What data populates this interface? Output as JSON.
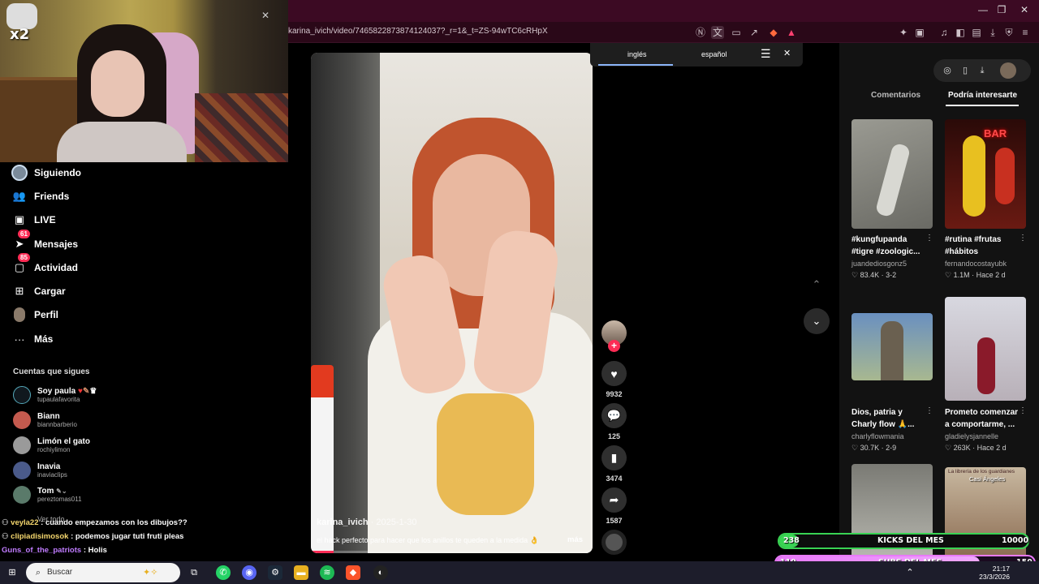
{
  "browser": {
    "url": "karina_ivich/video/7465822873874124037?_r=1&_t=ZS-94wTC6cRHpX"
  },
  "webcam": {
    "overlay_text": "x2"
  },
  "nav": {
    "items": [
      {
        "label": "Siguiendo",
        "icon": "avatar-icon"
      },
      {
        "label": "Friends",
        "icon": "friends-icon"
      },
      {
        "label": "LIVE",
        "icon": "live-icon"
      },
      {
        "label": "Mensajes",
        "icon": "messages-icon",
        "badge": "61"
      },
      {
        "label": "Actividad",
        "icon": "activity-icon",
        "badge": "85"
      },
      {
        "label": "Cargar",
        "icon": "upload-icon"
      },
      {
        "label": "Perfil",
        "icon": "profile-icon"
      },
      {
        "label": "Más",
        "icon": "more-icon"
      }
    ]
  },
  "following": {
    "title": "Cuentas que sigues",
    "accounts": [
      {
        "name": "Soy paula",
        "user": "tupaulafavorita",
        "avatar_color": "#10181e"
      },
      {
        "name": "Biann",
        "user": "biannbarberio",
        "avatar_color": "#c45a4e"
      },
      {
        "name": "Limón el gato",
        "user": "rochiylimon",
        "avatar_color": "#9a9a9a"
      },
      {
        "name": "Inavia",
        "user": "inaviaclips",
        "avatar_color": "#4a5a8a"
      },
      {
        "name": "Tom",
        "user": "pereztomas011",
        "avatar_color": "#5a7a6a"
      }
    ],
    "see_all": "Ver todo"
  },
  "chat": [
    {
      "user": "veyla22",
      "message": "cuando empezamos con los dibujos??",
      "color": "#f5d76e"
    },
    {
      "user": "clipiadisimosok",
      "message": "podemos jugar tuti fruti pleas",
      "color": "#f5d76e"
    },
    {
      "user": "Guns_of_the_patriots",
      "message": "Holis",
      "color": "#c07cff"
    }
  ],
  "video": {
    "author": "karina_ivich",
    "date": "2025-1-30",
    "caption": "el hack perfecto para hacer que los anillos te queden a la medida 👌",
    "more": "más",
    "progress": 0.08
  },
  "actions": {
    "likes": "9932",
    "comments": "125",
    "saves": "3474",
    "shares": "1587"
  },
  "translate": {
    "tab_source": "inglés",
    "tab_target": "español"
  },
  "panel": {
    "tabs": [
      "Comentarios",
      "Podría interesarte"
    ],
    "active_tab": 1,
    "cards": [
      {
        "title": "#kungfupanda #tigre #zoologic...",
        "user": "juandediosgonz5",
        "likes": "83.4K",
        "date": "3-2",
        "thumb_color": "#8a8a86"
      },
      {
        "title": "#rutina #frutas #hábitos",
        "user": "fernandocostayubk",
        "likes": "1.1M",
        "date": "Hace 2 d",
        "thumb_color": "#4a1a14",
        "thumb_text": "BAR"
      },
      {
        "title": "Dios, patria y Charly flow 🙏...",
        "user": "charlyflowmania",
        "likes": "30.7K",
        "date": "2-9",
        "thumb_color": "#7aa0c8"
      },
      {
        "title": "Prometo comenzar a comportarme, ...",
        "user": "gladielysjannelle",
        "likes": "263K",
        "date": "Hace 2 d",
        "thumb_color": "#c8c8d0"
      },
      {
        "title": "",
        "user": "",
        "likes": "",
        "date": "",
        "thumb_color": "#6a6a66"
      },
      {
        "title": "",
        "user": "",
        "likes": "",
        "date": "",
        "thumb_color": "#8a6a50",
        "thumb_text": "La librería de los guardianes",
        "thumb_subtext": "Casi Ángeles"
      }
    ]
  },
  "stream": {
    "kicks_label": "KICKS DEL MES",
    "kicks_value": "238",
    "kicks_goal": "10000",
    "kicks_progress": 0.024,
    "subs_label": "SUBS DEL MES",
    "subs_value": "119",
    "subs_goal": "150",
    "subs_progress": 0.79,
    "green": "#39d353",
    "pink": "#e879f9"
  },
  "taskbar": {
    "search_placeholder": "Buscar",
    "time": "21:17",
    "date": "23/3/2026",
    "whatsapp_badge": "4",
    "discord_badge": "4"
  },
  "colors": {
    "accent": "#fe2c55",
    "titlebar": "#3c0a23"
  }
}
